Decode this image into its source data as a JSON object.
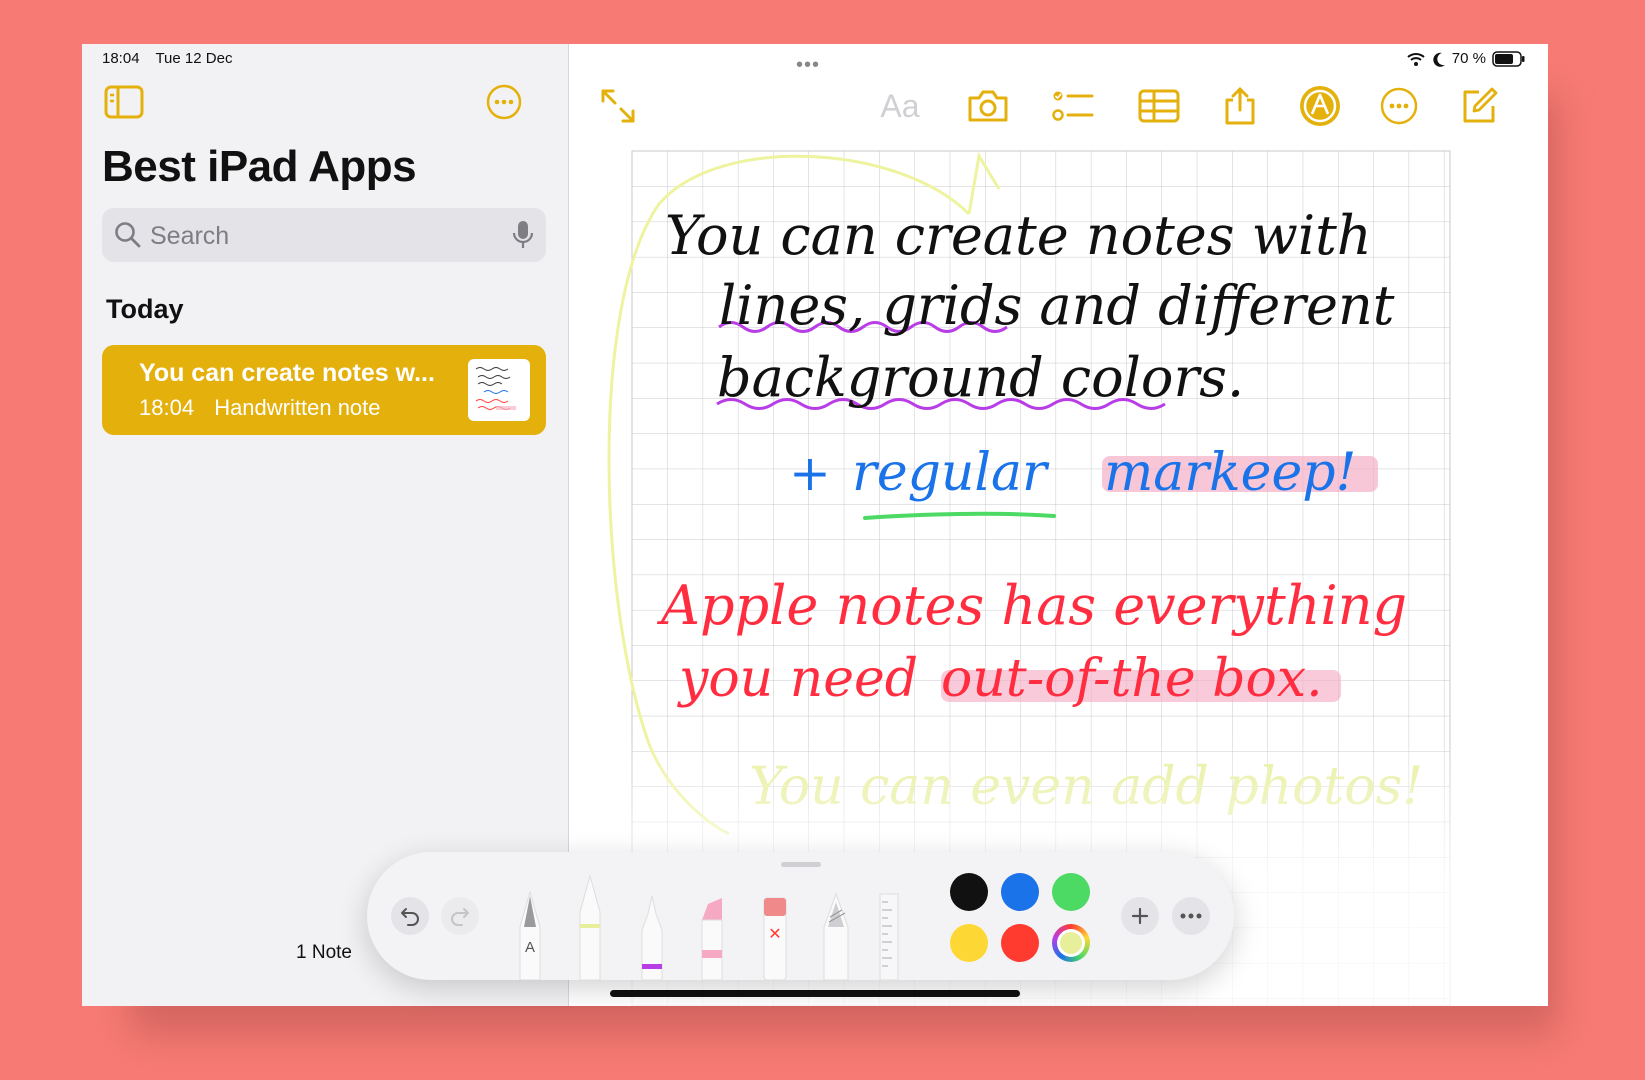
{
  "status": {
    "time": "18:04",
    "date": "Tue 12 Dec",
    "battery": "70 %"
  },
  "sidebar": {
    "title": "Best iPad Apps",
    "search_placeholder": "Search",
    "section": "Today",
    "note": {
      "title": "You can create notes w...",
      "time": "18:04",
      "subtitle": "Handwritten note"
    },
    "count": "1 Note"
  },
  "toolbar": {
    "format_label": "Aa",
    "icons": [
      "expand-icon",
      "format-icon",
      "camera-icon",
      "checklist-icon",
      "table-icon",
      "share-icon",
      "markup-icon",
      "more-icon",
      "compose-icon"
    ]
  },
  "note_content": {
    "line1": "You can create notes with",
    "line2": "lines, grids and different",
    "line3": "background colors.",
    "line4_plus": "+",
    "line4_a": "regular",
    "line4_b": "markeep!",
    "line5": "Apple notes has everything",
    "line6_a": "you need",
    "line6_b": "out-of-the box.",
    "line7": "You can even add photos!"
  },
  "palette": {
    "tools": [
      "pen",
      "marker",
      "fineliner",
      "highlighter",
      "eraser",
      "pencil",
      "ruler"
    ],
    "pen_label": "A",
    "colors": [
      "#111111",
      "#1a73e8",
      "#4cd964",
      "#fdd835",
      "#ff3b30"
    ],
    "accent": "#e4b00c"
  }
}
